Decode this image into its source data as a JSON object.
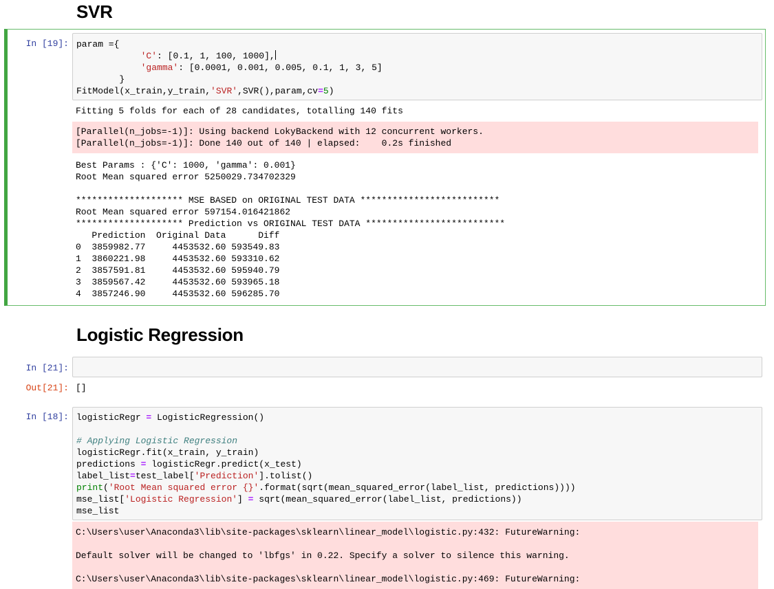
{
  "headings": {
    "svr": "SVR",
    "logistic": "Logistic Regression"
  },
  "cells": {
    "c19": {
      "prompt": "In [19]:",
      "code": {
        "l1": "param ={",
        "l2_key": "'C'",
        "l2_vals": "[0.1, 1, 100, 1000],",
        "l3_key": "'gamma'",
        "l3_vals": "[0.0001, 0.001, 0.005, 0.1, 1, 3, 5]",
        "l4": "}",
        "l5_a": "FitModel(x_train,y_train,",
        "l5_str": "'SVR'",
        "l5_b": ",SVR(),param,cv",
        "l5_eq": "=",
        "l5_num": "5",
        "l5_c": ")"
      },
      "stdout1": "Fitting 5 folds for each of 28 candidates, totalling 140 fits",
      "stderr": [
        "[Parallel(n_jobs=-1)]: Using backend LokyBackend with 12 concurrent workers.",
        "[Parallel(n_jobs=-1)]: Done 140 out of 140 | elapsed:    0.2s finished"
      ],
      "stdout2": [
        "Best Params : {'C': 1000, 'gamma': 0.001}",
        "Root Mean squared error 5250029.734702329",
        "",
        "******************** MSE BASED on ORIGINAL TEST DATA **************************",
        "Root Mean squared error 597154.016421862",
        "******************** Prediction vs ORIGINAL TEST DATA **************************"
      ],
      "table": {
        "header": "   Prediction  Original Data      Diff",
        "rows": [
          "0  3859982.77     4453532.60 593549.83",
          "1  3860221.98     4453532.60 593310.62",
          "2  3857591.81     4453532.60 595940.79",
          "3  3859567.42     4453532.60 593965.18",
          "4  3857246.90     4453532.60 596285.70"
        ]
      }
    },
    "c21": {
      "prompt_in": "In [21]:",
      "prompt_out": "Out[21]:",
      "output": "[]"
    },
    "c18": {
      "prompt": "In [18]:",
      "code": {
        "l1_a": "logisticRegr ",
        "l1_eq": "=",
        "l1_b": " LogisticRegression()",
        "l3_comment": "# Applying Logistic Regression",
        "l4": "logisticRegr.fit(x_train, y_train)",
        "l5_a": "predictions ",
        "l5_eq": "=",
        "l5_b": " logisticRegr.predict(x_test)",
        "l6_a": "label_list",
        "l6_eq": "=",
        "l6_b": "test_label[",
        "l6_str": "'Prediction'",
        "l6_c": "].tolist()",
        "l7_kw": "print",
        "l7_a": "(",
        "l7_str": "'Root Mean squared error {}'",
        "l7_b": ".format(sqrt(mean_squared_error(label_list, predictions))))",
        "l8_a": "mse_list[",
        "l8_str": "'Logistic Regression'",
        "l8_b": "] ",
        "l8_eq": "=",
        "l8_c": " sqrt(mean_squared_error(label_list, predictions))",
        "l9": "mse_list"
      },
      "stderr": [
        "C:\\Users\\user\\Anaconda3\\lib\\site-packages\\sklearn\\linear_model\\logistic.py:432: FutureWarning:",
        "",
        "Default solver will be changed to 'lbfgs' in 0.22. Specify a solver to silence this warning.",
        "",
        "C:\\Users\\user\\Anaconda3\\lib\\site-packages\\sklearn\\linear_model\\logistic.py:469: FutureWarning:"
      ]
    }
  },
  "colors": {
    "prompt_in": "#303f9f",
    "prompt_out": "#d84315",
    "string": "#ba2121",
    "number": "#008000",
    "operator": "#aa22ff",
    "comment": "#408080",
    "stderr_bg": "#ffdddd",
    "selected_border": "#42a542"
  }
}
